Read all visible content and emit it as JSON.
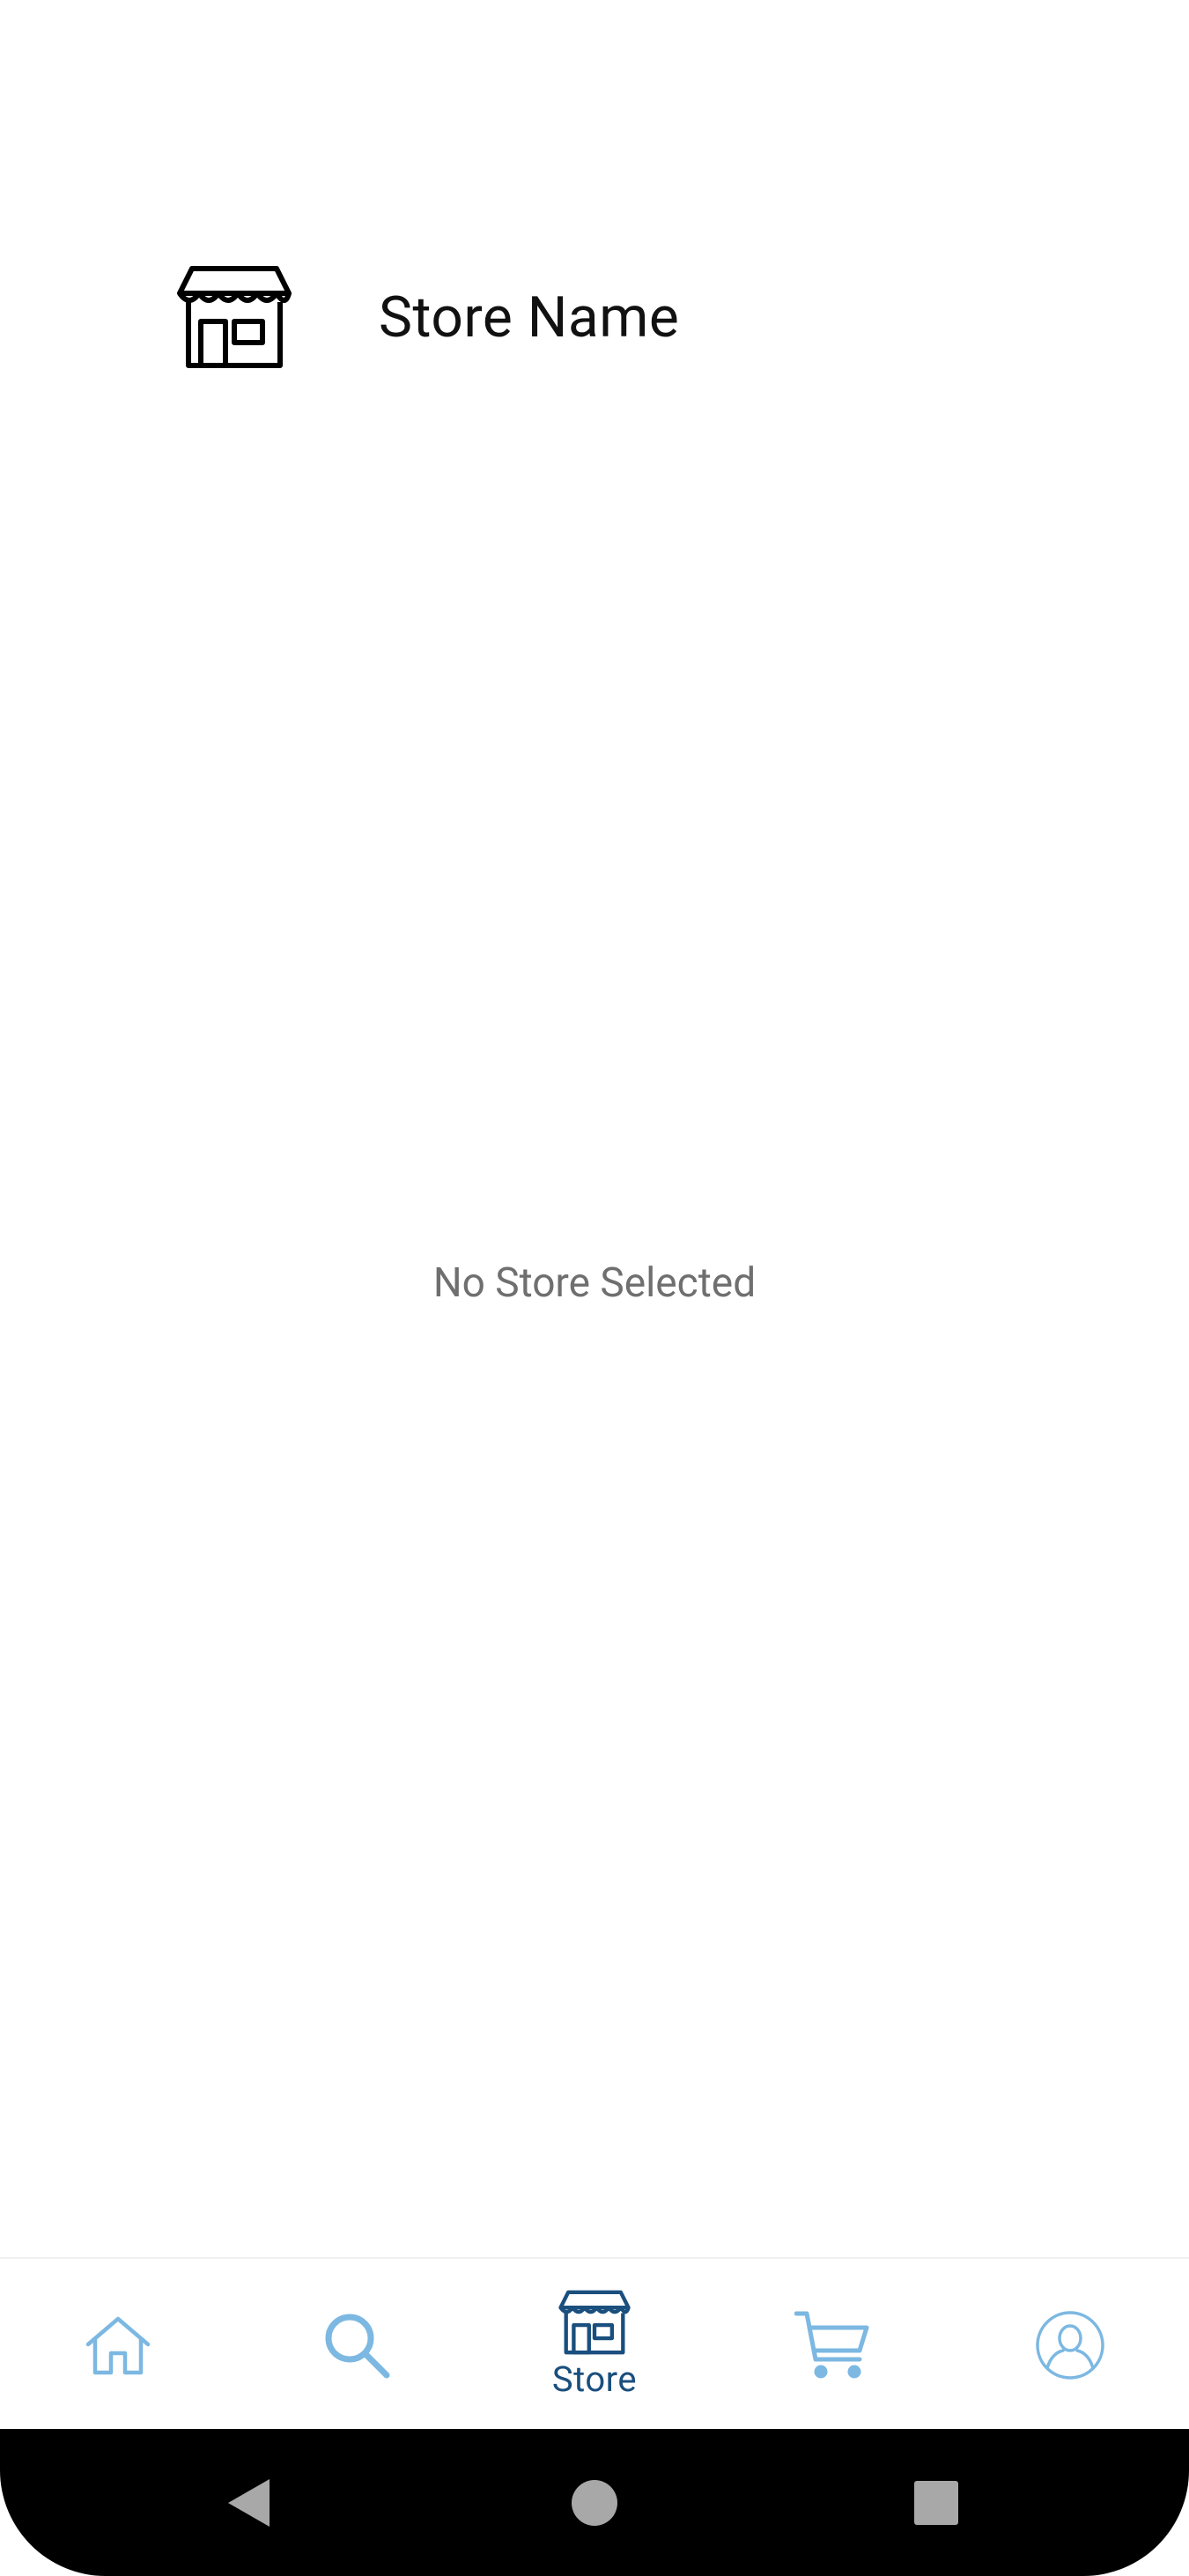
{
  "header": {
    "store_name_label": "Store Name",
    "icon": "storefront-icon"
  },
  "empty_state": {
    "message": "No Store Selected"
  },
  "bottom_nav": {
    "items": [
      {
        "icon": "home-icon",
        "label": "",
        "active": false
      },
      {
        "icon": "search-icon",
        "label": "",
        "active": false
      },
      {
        "icon": "storefront-icon",
        "label": "Store",
        "active": true
      },
      {
        "icon": "cart-icon",
        "label": "",
        "active": false
      },
      {
        "icon": "profile-icon",
        "label": "",
        "active": false
      }
    ]
  },
  "system_nav": {
    "buttons": [
      "back-icon",
      "home-circle-icon",
      "recents-square-icon"
    ]
  },
  "colors": {
    "inactive_nav": "#7cb8e2",
    "active_nav": "#1a4f7e",
    "empty_text": "#6f6f6f",
    "system_bar": "#000000"
  }
}
